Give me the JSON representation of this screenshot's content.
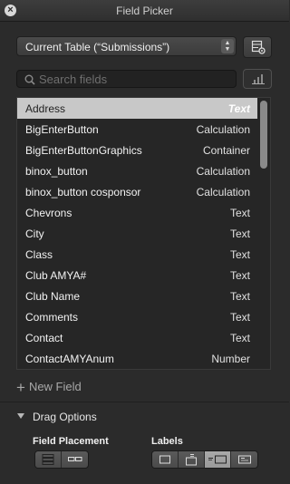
{
  "window": {
    "title": "Field Picker"
  },
  "table_select": {
    "label": "Current Table (“Submissions”)"
  },
  "search": {
    "placeholder": "Search fields",
    "value": ""
  },
  "fields": [
    {
      "name": "Address",
      "type": "Text",
      "selected": true
    },
    {
      "name": "BigEnterButton",
      "type": "Calculation"
    },
    {
      "name": "BigEnterButtonGraphics",
      "type": "Container"
    },
    {
      "name": "binox_button",
      "type": "Calculation"
    },
    {
      "name": "binox_button cosponsor",
      "type": "Calculation"
    },
    {
      "name": "Chevrons",
      "type": "Text"
    },
    {
      "name": "City",
      "type": "Text"
    },
    {
      "name": "Class",
      "type": "Text"
    },
    {
      "name": "Club AMYA#",
      "type": "Text"
    },
    {
      "name": "Club Name",
      "type": "Text"
    },
    {
      "name": "Comments",
      "type": "Text"
    },
    {
      "name": "Contact",
      "type": "Text"
    },
    {
      "name": "ContactAMYAnum",
      "type": "Number"
    }
  ],
  "new_field": {
    "label": "New Field"
  },
  "drag_options": {
    "label": "Drag Options",
    "field_placement": {
      "label": "Field Placement",
      "options": [
        "vertical",
        "horizontal"
      ],
      "selected": 0
    },
    "labels": {
      "label": "Labels",
      "options": [
        "none",
        "top",
        "left",
        "right"
      ],
      "selected": 2
    }
  },
  "colors": {
    "background": "#2b2b2b",
    "selection": "#c8c8c8",
    "segment_active": "#a9a9a9"
  }
}
